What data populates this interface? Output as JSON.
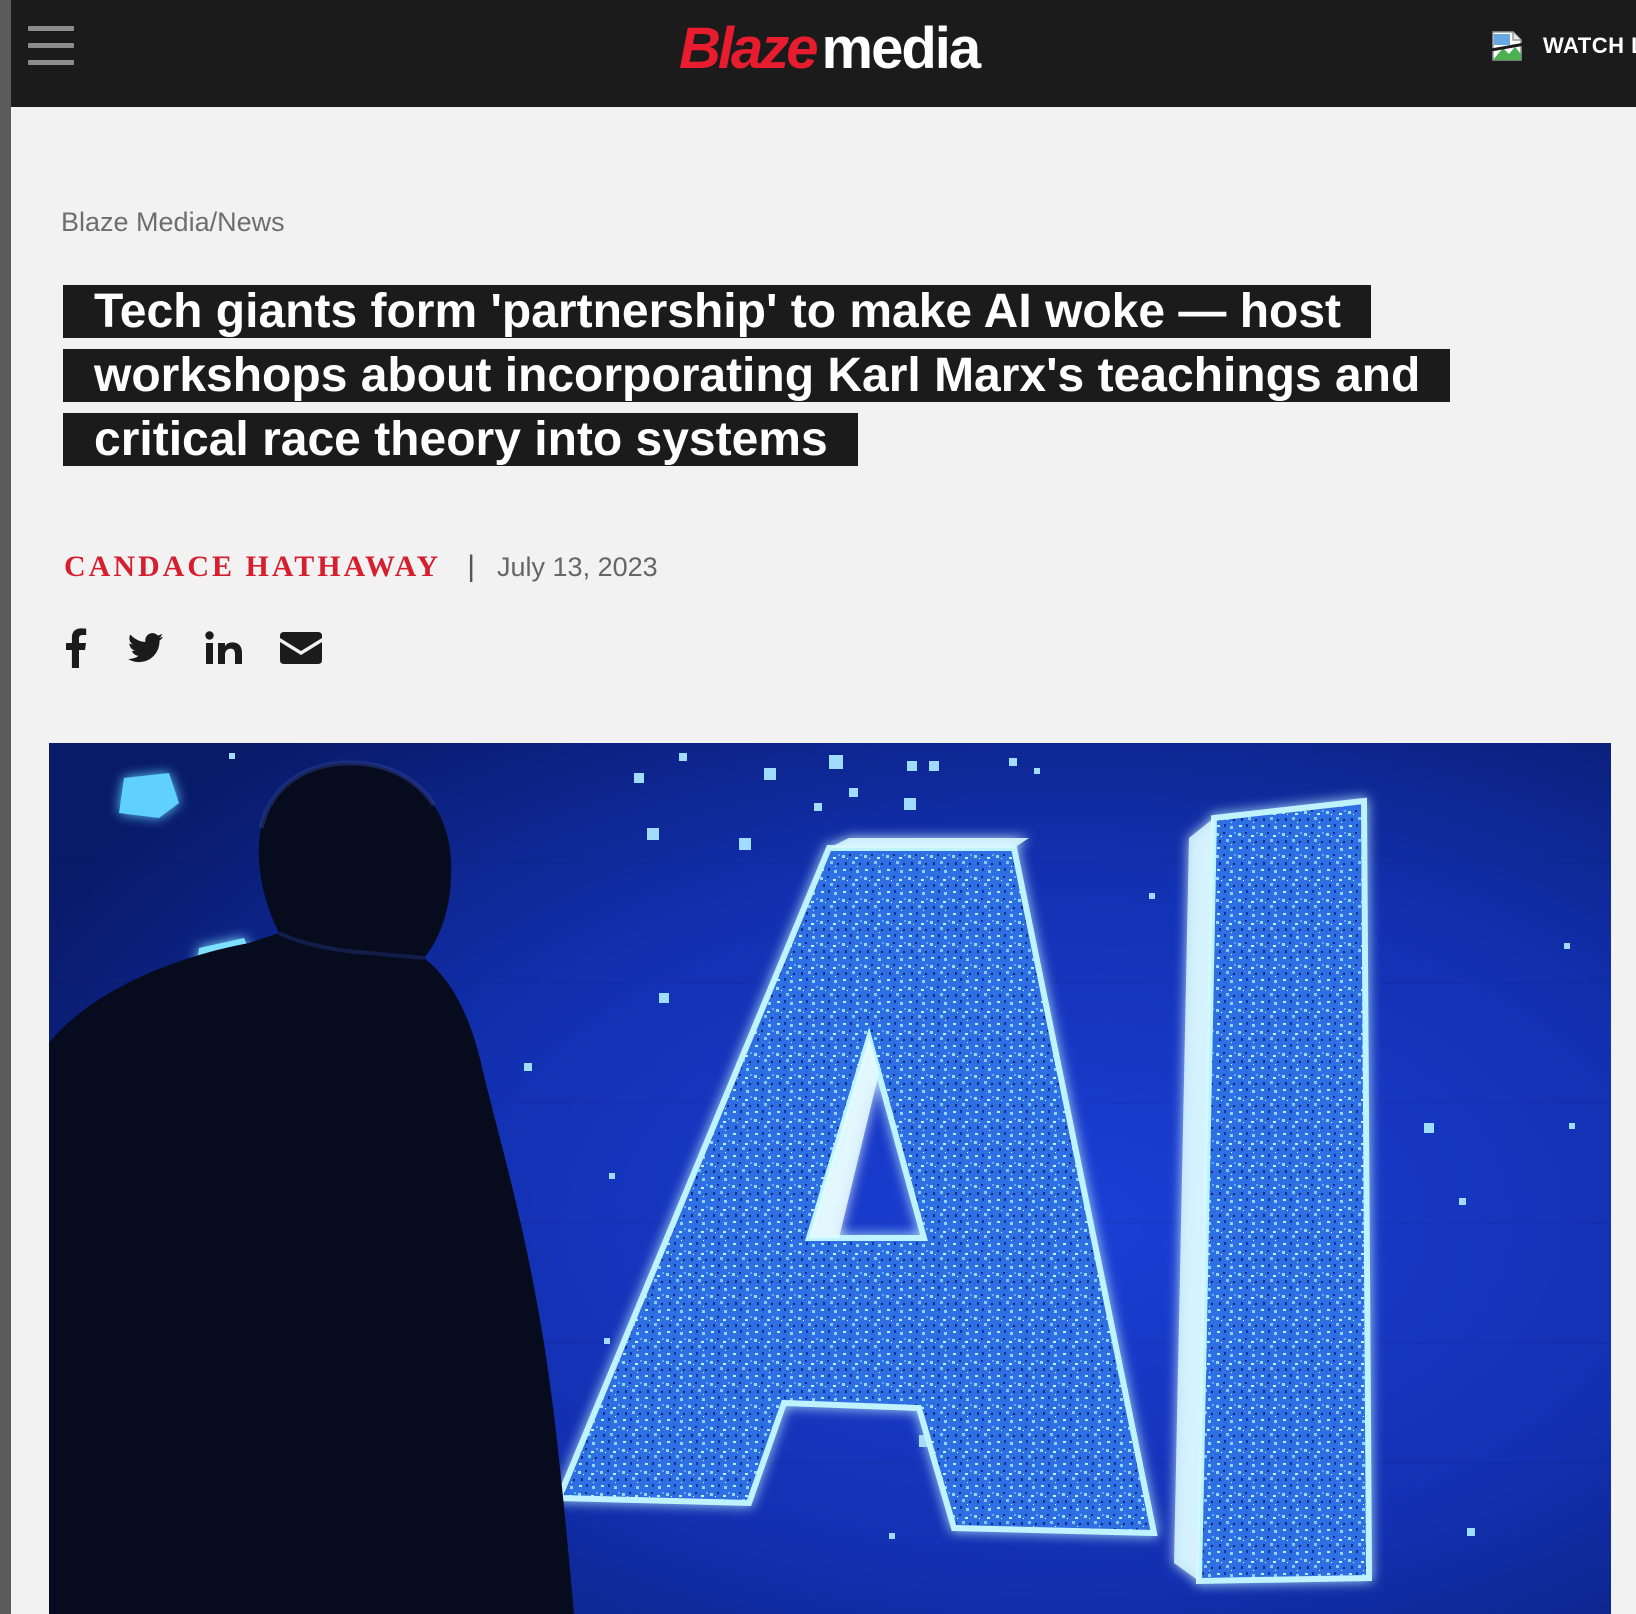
{
  "header": {
    "logo_part1": "Blaze",
    "logo_part2": "media",
    "watch_label": "WATCH LI",
    "brand_color": "#e81c2e",
    "bar_color": "#1b1b1b"
  },
  "icons": {
    "menu": "hamburger-menu-icon",
    "watch": "broken-image-icon",
    "share": [
      "facebook-icon",
      "twitter-icon",
      "linkedin-icon",
      "email-icon"
    ]
  },
  "article": {
    "breadcrumb": "Blaze Media/News",
    "headline": "Tech giants form 'partnership' to make AI woke — host workshops about incorporating Karl Marx's teachings and critical race theory into systems",
    "author": "CANDACE HATHAWAY",
    "separator": "|",
    "date": "July 13, 2023",
    "author_color": "#d51f2e"
  },
  "hero": {
    "subject_text": "AI"
  }
}
